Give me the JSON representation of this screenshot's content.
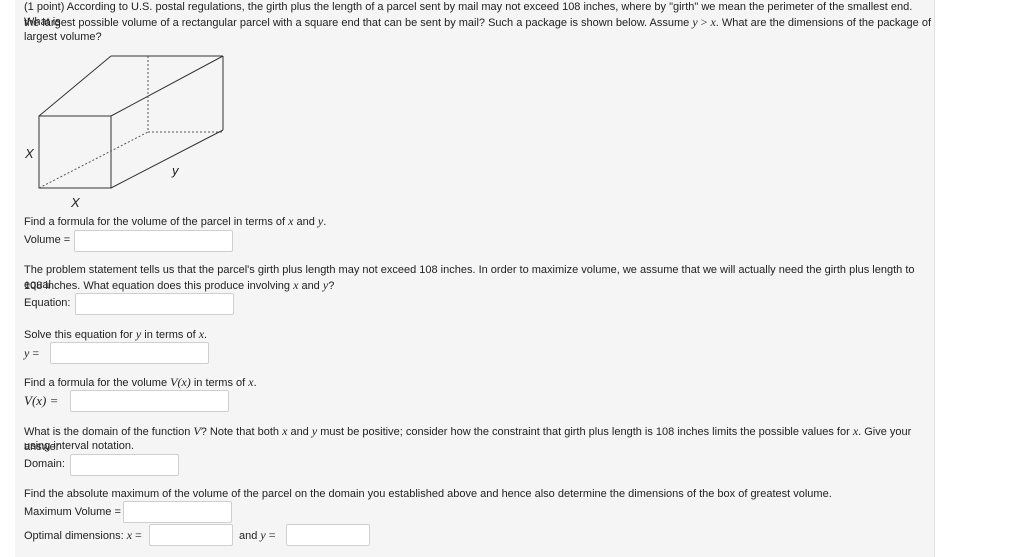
{
  "problem": {
    "intro_lines": [
      "(1 point) According to U.S. postal regulations, the girth plus the length of a parcel sent by mail may not exceed 108 inches, where by \"girth\" we mean the perimeter of the smallest end. What is",
      "the largest possible volume of a rectangular parcel with a square end that can be sent by mail? Such a package is shown below. Assume",
      "largest volume?"
    ],
    "assume_y": "y",
    "assume_gt": " > ",
    "assume_x": "x",
    "assume_tail": ". What are the dimensions of the package of"
  },
  "diagram": {
    "label_left": "X",
    "label_bottom": "X",
    "label_depth": "y"
  },
  "part1": {
    "prompt_a": "Find a formula for the volume of the parcel in terms of ",
    "x": "x",
    "and": " and ",
    "y": "y",
    "end": ".",
    "field_label": "Volume =",
    "value": ""
  },
  "part2": {
    "line1": "The problem statement tells us that the parcel's girth plus length may not exceed 108 inches. In order to maximize volume, we assume that we will actually need the girth plus length to equal",
    "line2_a": "108 inches. What equation does this produce involving ",
    "x": "x",
    "and": " and ",
    "y": "y",
    "end": "?",
    "field_label": "Equation:",
    "value": ""
  },
  "part3": {
    "prompt_a": "Solve this equation for ",
    "y": "y",
    "mid": " in terms of ",
    "x": "x",
    "end": ".",
    "field_label_var": "y",
    "field_label_eq": " =",
    "value": ""
  },
  "part4": {
    "prompt_a": "Find a formula for the volume ",
    "fn": "V(x)",
    "mid": " in terms of ",
    "x": "x",
    "end": ".",
    "field_label": "V(x) =",
    "value": ""
  },
  "part5": {
    "line1_a": "What is the domain of the function ",
    "V": "V",
    "line1_b": "? Note that both ",
    "x": "x",
    "and": " and ",
    "y": "y",
    "line1_c": " must be positive; consider how the constraint that girth plus length is 108 inches limits the possible values for ",
    "x2": "x",
    "line1_d": ". Give your answer",
    "line2": "using interval notation.",
    "field_label": "Domain:",
    "value": ""
  },
  "part6": {
    "prompt": "Find the absolute maximum of the volume of the parcel on the domain you established above and hence also determine the dimensions of the box of greatest volume.",
    "max_label": "Maximum Volume =",
    "max_value": "",
    "opt_label": "Optimal dimensions: ",
    "opt_x": "x",
    "opt_eq": " =",
    "and": "and ",
    "opt_y": "y",
    "opt_eq2": " =",
    "x_value": "",
    "y_value": ""
  }
}
